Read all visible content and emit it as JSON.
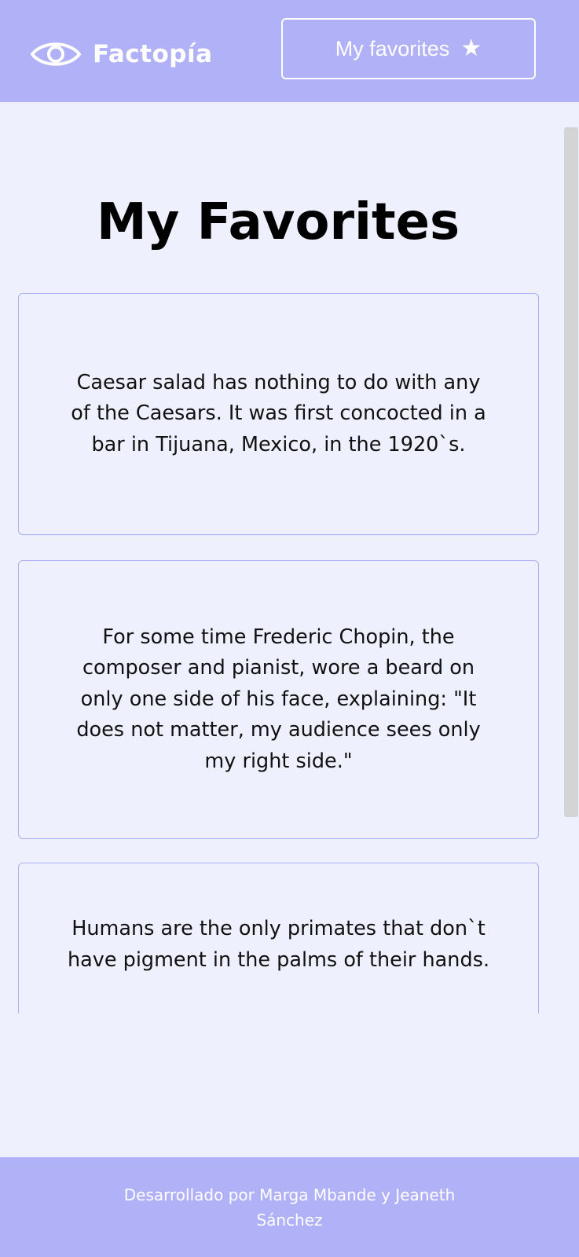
{
  "header": {
    "logo_text": "Factopía",
    "logo_icon": "eye-icon",
    "favorites_button": {
      "label": "My favorites",
      "icon": "star-icon",
      "glyph": "★"
    }
  },
  "main": {
    "title": "My Favorites",
    "cards": [
      {
        "text": "Caesar salad has nothing to do with any of the Caesars. It was first concocted in a bar in Tijuana, Mexico, in the 1920`s."
      },
      {
        "text": "For some time Frederic Chopin, the composer and pianist, wore a beard on only one side of his face, explaining: \"It does not matter, my audience sees only my right side.\""
      },
      {
        "text": "Humans are the only primates that don`t have pigment in the palms of their hands."
      }
    ]
  },
  "footer": {
    "credit": "Desarrollado por Marga Mbande y Jeaneth Sánchez"
  },
  "colors": {
    "header_bg": "#b1b1f8",
    "page_bg": "#eef0fd",
    "card_border": "#aab0f2"
  }
}
